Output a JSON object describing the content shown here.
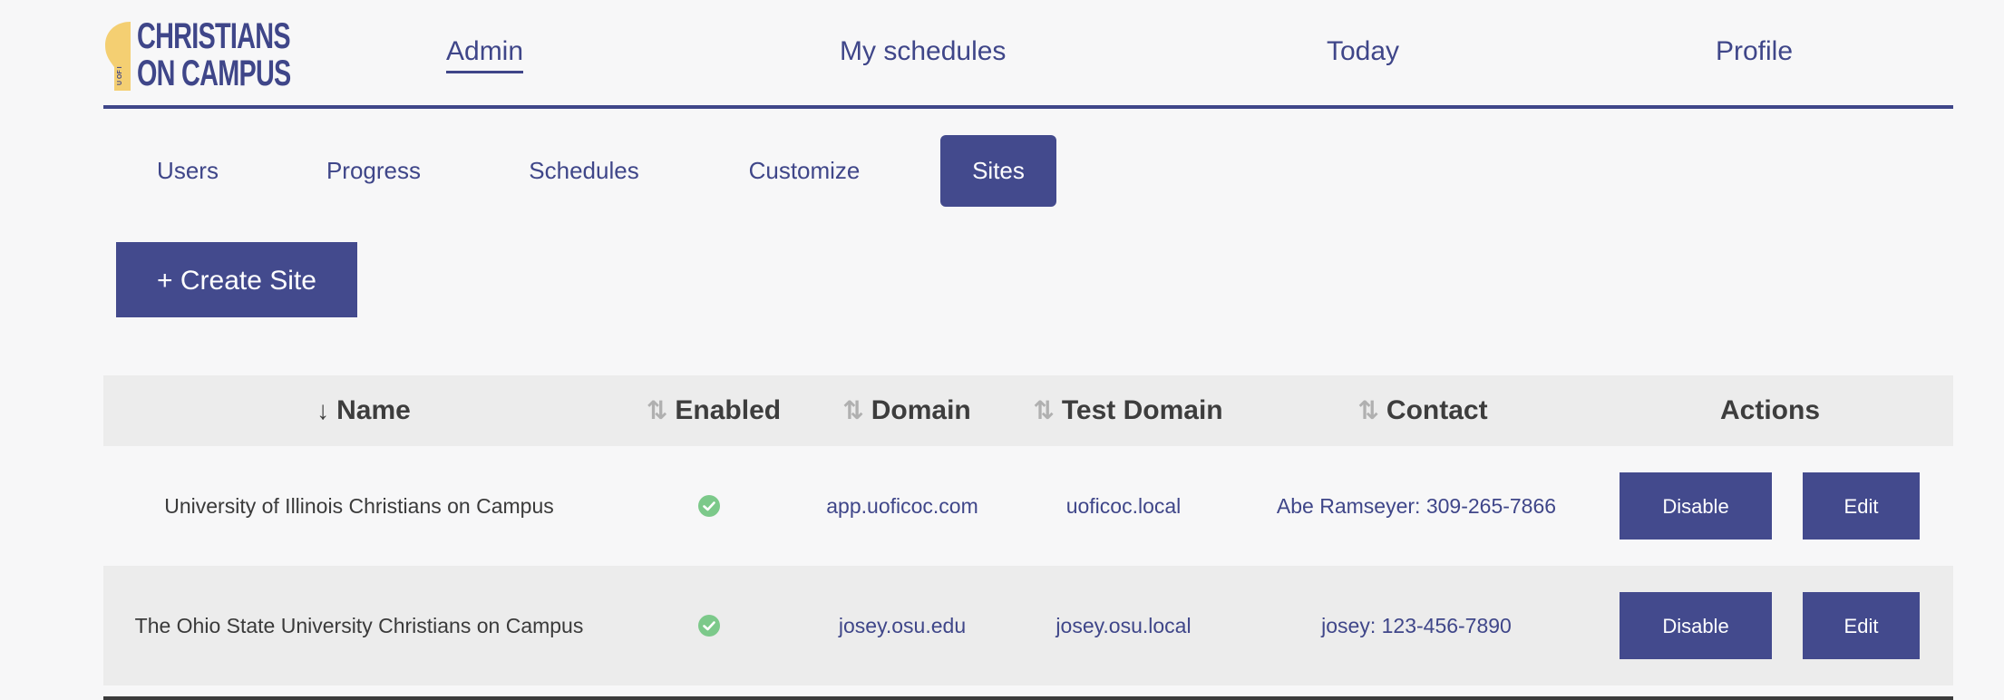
{
  "brand": {
    "logo_line1": "CHRISTIANS",
    "logo_line2": "ON CAMPUS",
    "logo_small": "U OF I",
    "colors": {
      "primary": "#434a8d",
      "bulb": "#f4cf72",
      "check": "#7cc98a"
    }
  },
  "main_nav": {
    "items": [
      {
        "label": "Admin",
        "active": true
      },
      {
        "label": "My schedules"
      },
      {
        "label": "Today"
      },
      {
        "label": "Profile"
      }
    ]
  },
  "sub_tabs": {
    "items": [
      {
        "label": "Users"
      },
      {
        "label": "Progress"
      },
      {
        "label": "Schedules"
      },
      {
        "label": "Customize"
      },
      {
        "label": "Sites",
        "active": true
      }
    ]
  },
  "create_button": {
    "label": "+ Create Site"
  },
  "table": {
    "headers": {
      "name": "Name",
      "enabled": "Enabled",
      "domain": "Domain",
      "test_domain": "Test Domain",
      "contact": "Contact",
      "actions": "Actions"
    },
    "sort_icons": {
      "active": "arrow-down-icon",
      "inactive": "sort-updown-icon"
    },
    "rows": [
      {
        "name": "University of Illinois Christians on Campus",
        "enabled": true,
        "domain": "app.uoficoc.com",
        "test_domain": "uoficoc.local",
        "contact": "Abe Ramseyer: 309-265-7866",
        "disable_label": "Disable",
        "edit_label": "Edit"
      },
      {
        "name": "The Ohio State University Christians on Campus",
        "enabled": true,
        "domain": "josey.osu.edu",
        "test_domain": "josey.osu.local",
        "contact": "josey: 123-456-7890",
        "disable_label": "Disable",
        "edit_label": "Edit"
      }
    ]
  }
}
